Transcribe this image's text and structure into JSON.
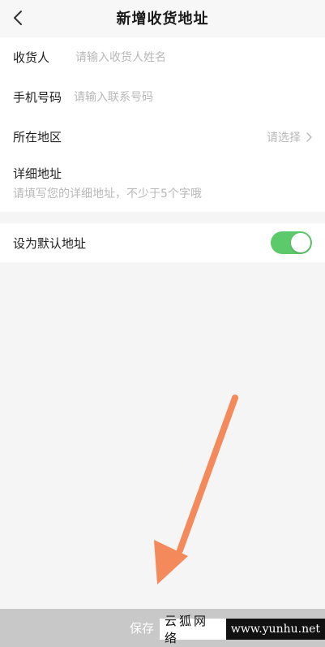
{
  "header": {
    "title": "新增收货地址",
    "back_icon": "chevron-left-icon"
  },
  "form": {
    "recipient": {
      "label": "收货人",
      "placeholder": "请输入收货人姓名",
      "value": ""
    },
    "phone": {
      "label": "手机号码",
      "placeholder": "请输入联系号码",
      "value": ""
    },
    "region": {
      "label": "所在地区",
      "placeholder": "请选择",
      "icon": "chevron-right-icon"
    },
    "address": {
      "label": "详细地址",
      "placeholder": "请填写您的详细地址，不少于5个字哦",
      "value": ""
    }
  },
  "default_setting": {
    "label": "设为默认地址",
    "enabled": true,
    "toggle_color": "#5cc96b"
  },
  "save_button": {
    "label": "保存"
  },
  "watermark": {
    "cn": "云狐网络",
    "en": "www.yunhu.net"
  },
  "colors": {
    "accent_green": "#5cc96b",
    "annotation_arrow": "#f48a5b",
    "placeholder": "#b8b8b8",
    "background": "#f5f5f5"
  }
}
